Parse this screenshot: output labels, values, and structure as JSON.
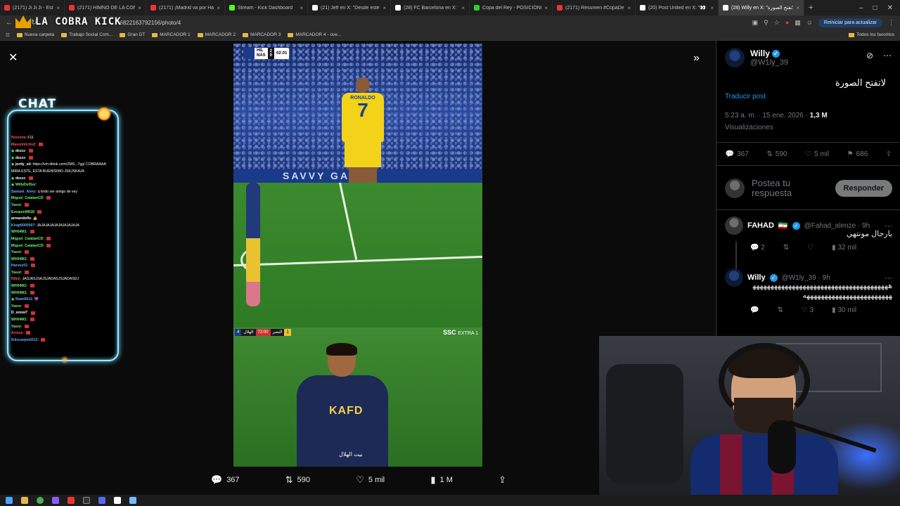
{
  "browser": {
    "tabs": [
      {
        "label": "(2171) Ji Ji Ji - Estadio Único d",
        "color": "#e33"
      },
      {
        "label": "(2171) HIMNO DE LA CONME",
        "color": "#e33"
      },
      {
        "label": "(2171) ¡Madrid va por Haalan",
        "color": "#e33"
      },
      {
        "label": "Stream - Kick Dashboard",
        "color": "#53fc18"
      },
      {
        "label": "(21) Jeff en X: \"Desde este día",
        "color": "#fff"
      },
      {
        "label": "(28) FC Barcelona en X: \"✅ B",
        "color": "#fff"
      },
      {
        "label": "Copa del Rey - POSICIONES",
        "color": "#3c3"
      },
      {
        "label": "(2171) Resumen #CopaDelRe",
        "color": "#e33"
      },
      {
        "label": "(20) Post United en X: \"👀 @",
        "color": "#fff"
      },
      {
        "label": "(28) Willy en X: \"لاتفتح الصورة\"",
        "color": "#fff",
        "active": true
      }
    ],
    "url": "6822163792156/photo/4",
    "update_button": "Reiniciar para actualizar",
    "bookmarks": [
      "Nueva carpeta",
      "Trabajo Social Com...",
      "Gran DT",
      "MARCADOR 1",
      "MARCADOR 2",
      "MARCADOR 3",
      "MARCADOR 4 - ove..."
    ],
    "all_favorites": "Todos los favoritos"
  },
  "stream": {
    "logo_text": "LA COBRA KICK",
    "chat_title": "CHAT",
    "chat": [
      {
        "user": "Noventa",
        "msg": ": F11",
        "color": "#ff4d4d",
        "emote": false
      },
      {
        "user": "Massimilcito2",
        "msg": ": ",
        "color": "#ff4d4d",
        "emote": true
      },
      {
        "user": "dezzz",
        "msg": ": ",
        "color": "#ffffff",
        "emote": true,
        "badge": true
      },
      {
        "user": "dezzz",
        "msg": ": ",
        "color": "#ffffff",
        "emote": true,
        "badge": true
      },
      {
        "user": "jordy_xd",
        "msg": ": https://vm.tiktok.com/ZMS...7gg/ COBRAAAA",
        "color": "#ffffff",
        "emote": false,
        "badge": true
      },
      {
        "user": "",
        "msg": "MIRA ESTE, ESTA BUENISIMO JSKJSKAJA",
        "color": "#ffffff",
        "emote": false
      },
      {
        "user": "dezzz",
        "msg": ": ",
        "color": "#ffffff",
        "emote": true,
        "badge": true
      },
      {
        "user": "WillyDelSur",
        "msg": ": ",
        "color": "#6ef36e",
        "emote": false,
        "badge": true
      },
      {
        "user": "Samuel_Alvez",
        "msg": ": q lindo ser amigo de vey",
        "color": "#6aa8ff",
        "emote": false
      },
      {
        "user": "Miguel_CatalanCD",
        "msg": ": ",
        "color": "#6ef36e",
        "emote": true
      },
      {
        "user": "Yasor",
        "msg": ": ",
        "color": "#6ef36e",
        "emote": true
      },
      {
        "user": "Ezequiel0818",
        "msg": ": ",
        "color": "#6ef36e",
        "emote": true
      },
      {
        "user": "armandofls",
        "msg": ": 👍",
        "color": "#ffffff",
        "emote": false
      },
      {
        "user": "Kingt0000007",
        "msg": ": JAJAJAJAJAJAJAJAJAJA",
        "color": "#6aa8ff",
        "emote": false
      },
      {
        "user": "WH04M1",
        "msg": ": ",
        "color": "#6ef36e",
        "emote": true
      },
      {
        "user": "Miguel_CatalanCD",
        "msg": ": ",
        "color": "#6ef36e",
        "emote": true
      },
      {
        "user": "Miguel_CatalanCD",
        "msg": ": ",
        "color": "#6ef36e",
        "emote": true
      },
      {
        "user": "Yasor",
        "msg": ": ",
        "color": "#6ef36e",
        "emote": true
      },
      {
        "user": "WH04M1",
        "msg": ": ",
        "color": "#6ef36e",
        "emote": true
      },
      {
        "user": "Harvey01",
        "msg": ": ",
        "color": "#6aa8ff",
        "emote": true
      },
      {
        "user": "Yasor",
        "msg": ": ",
        "color": "#6ef36e",
        "emote": true
      },
      {
        "user": "Nibis",
        "msg": ": JASJASJSAJSJADASJSJADASDJ",
        "color": "#ff4d4d",
        "emote": false
      },
      {
        "user": "WH04M1",
        "msg": ": ",
        "color": "#6ef36e",
        "emote": true
      },
      {
        "user": "WH04M1",
        "msg": ": ",
        "color": "#6ef36e",
        "emote": true
      },
      {
        "user": "Rami0611",
        "msg": ": 💜",
        "color": "#6aa8ff",
        "emote": false,
        "badge": true
      },
      {
        "user": "Yasor",
        "msg": ": ",
        "color": "#6ef36e",
        "emote": true
      },
      {
        "user": "D_snow7",
        "msg": ": ",
        "color": "#ffffff",
        "emote": true
      },
      {
        "user": "WH04M1",
        "msg": ": ",
        "color": "#6ef36e",
        "emote": true
      },
      {
        "user": "Yasor",
        "msg": ": ",
        "color": "#6ef36e",
        "emote": true
      },
      {
        "user": "Armee",
        "msg": ": ",
        "color": "#ff4d4d",
        "emote": true
      },
      {
        "user": "felixcarpio9312",
        "msg": ": ",
        "color": "#6aa8ff",
        "emote": true
      }
    ]
  },
  "viewer": {
    "photo": {
      "scorebug_teams": [
        "HIL",
        "NAS"
      ],
      "scorebug_score": [
        "2",
        "0"
      ],
      "scorebug_time": "02:01",
      "shirt_name": "RONALDO",
      "shirt_number": "7",
      "banner_text": "SAVVY GAMES",
      "closeup_bar": [
        "4",
        "الهلال",
        "72:00",
        "النصر",
        "1"
      ],
      "closeup_brand": "SSC",
      "closeup_channel": "EXTRA 1",
      "jersey_sponsor": "KAFD",
      "caption": "بيت الهلال"
    },
    "actions": {
      "replies": "367",
      "reposts": "590",
      "likes": "5 mil",
      "views": "1 M"
    }
  },
  "post": {
    "author": "Willy",
    "handle": "@W1ly_39",
    "text": "لاتفتح الصورة",
    "translate": "Traducir post",
    "timestamp": "5:23 a. m. · 15 ene. 2026 ·",
    "views_count": "1,3 M",
    "views_label": "Visualizaciones",
    "stats": {
      "replies": "367",
      "reposts": "590",
      "likes": "5 mil",
      "bookmarks": "686"
    },
    "reply_placeholder": "Postea tu respuesta",
    "reply_button": "Responder"
  },
  "replies": [
    {
      "name": "FAHAD",
      "flag": "🇮🇷",
      "handle": "@Fahad_alenze · 9h",
      "text": "يارجال مونتهي",
      "replies": "2",
      "likes": "",
      "views": "32 mil"
    },
    {
      "name": "Willy",
      "flag": "",
      "handle": "@W1ly_39 · 9h",
      "text": "هههههههههههههههههههههههههههههههههههههههههههههههههههههههههههههههه",
      "replies": "",
      "likes": "3",
      "views": "30 mil"
    }
  ],
  "colors": {
    "accent": "#1d9bf0",
    "background": "#000000",
    "chat_border": "#9ee6ff"
  }
}
